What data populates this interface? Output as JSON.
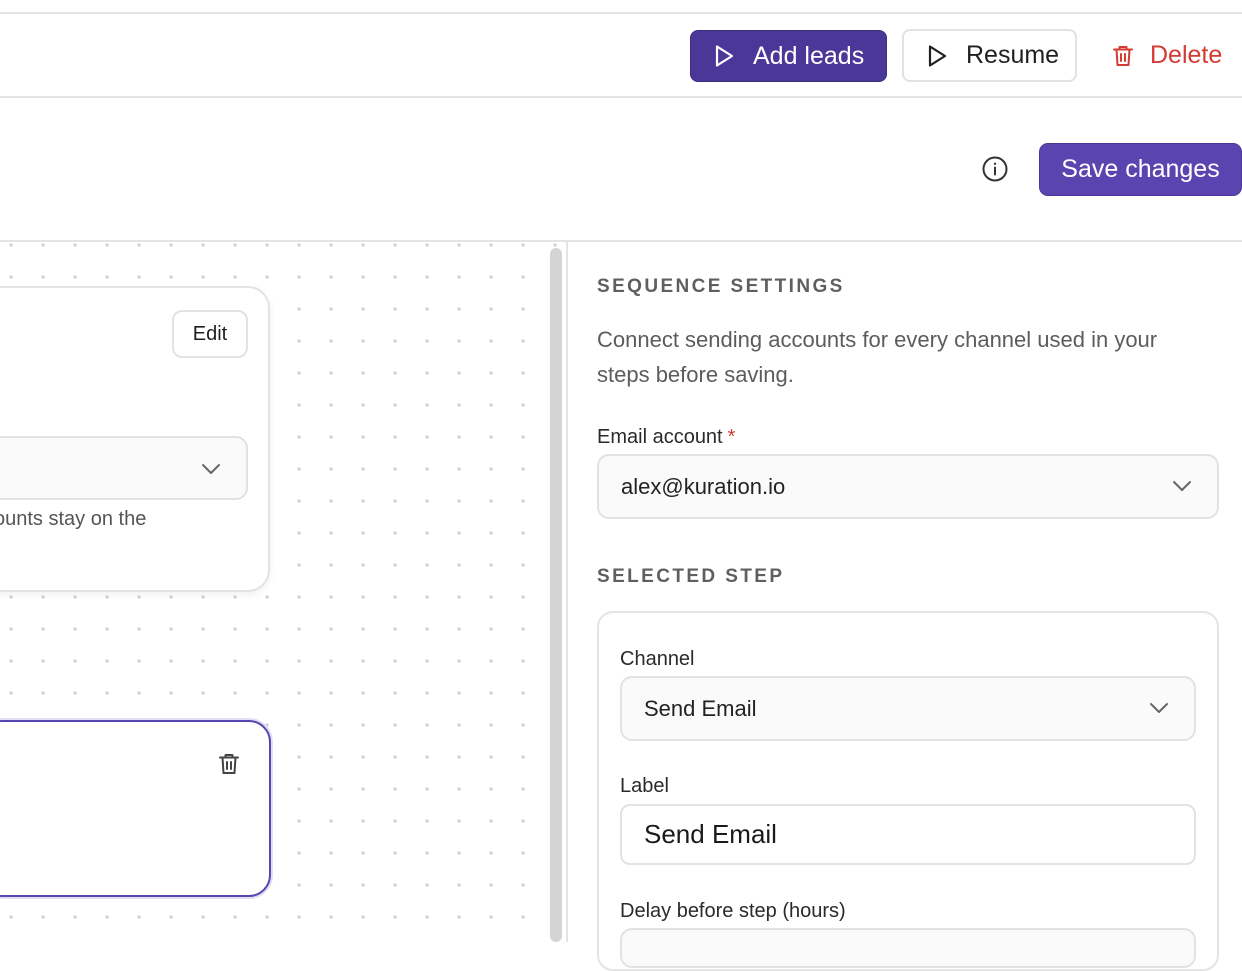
{
  "header": {
    "add_leads_label": "Add leads",
    "resume_label": "Resume",
    "delete_label": "Delete"
  },
  "toolbar": {
    "save_label": "Save changes"
  },
  "canvas": {
    "node": {
      "edit_label": "Edit",
      "note_text": "ounts stay on the"
    }
  },
  "settings": {
    "section_title": "SEQUENCE SETTINGS",
    "description": "Connect sending accounts for every channel used in your steps before saving.",
    "email_account_label": "Email account",
    "required_mark": "*",
    "email_account_value": "alex@kuration.io"
  },
  "selected_step": {
    "section_title": "SELECTED STEP",
    "channel_label": "Channel",
    "channel_value": "Send Email",
    "label_label": "Label",
    "label_value": "Send Email",
    "delay_label": "Delay before step (hours)"
  },
  "colors": {
    "primary": "#4a3797",
    "primary_light": "#5a44b0",
    "danger": "#d53a33"
  },
  "icons": {
    "play": "play-icon",
    "trash": "trash-icon",
    "info": "info-icon",
    "chevron": "chevron-down-icon"
  }
}
